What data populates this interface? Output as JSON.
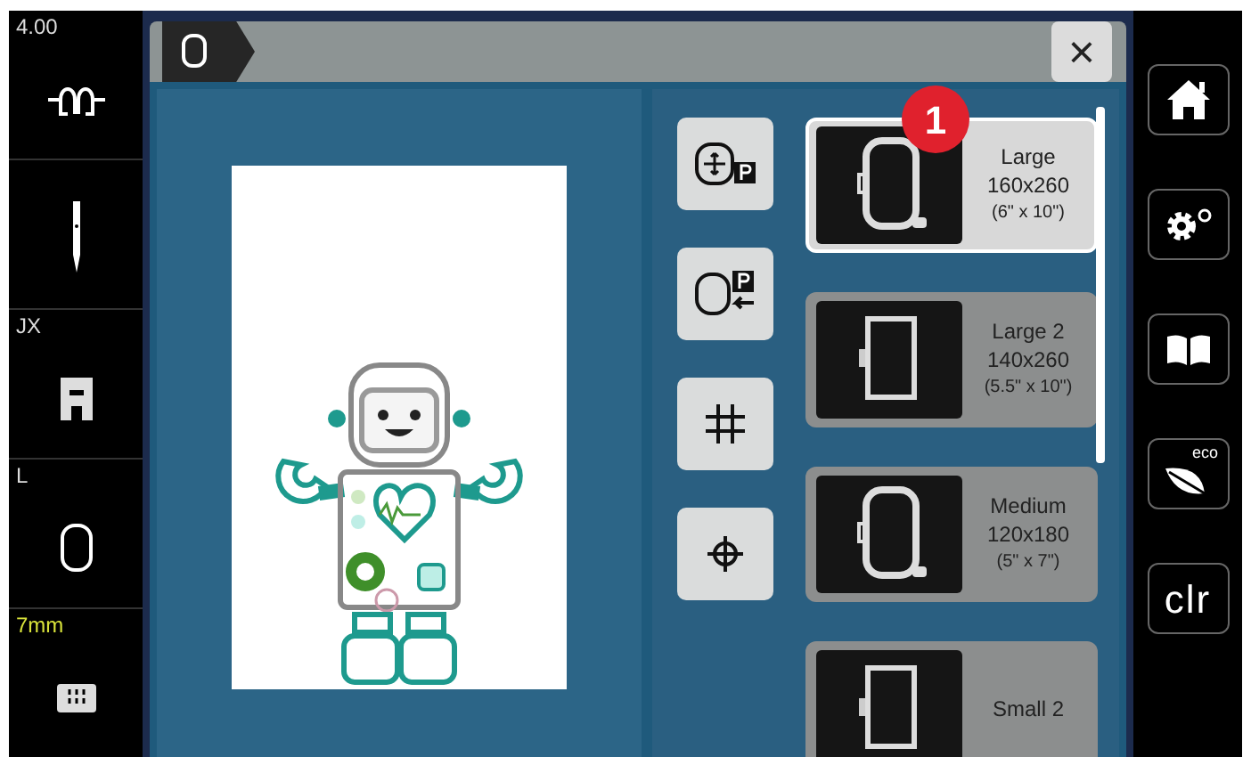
{
  "left_sidebar": [
    {
      "kind": "tension",
      "label": "4.00"
    },
    {
      "kind": "needle"
    },
    {
      "kind": "foot",
      "label": "JX"
    },
    {
      "kind": "hoop",
      "label": "L"
    },
    {
      "kind": "plate",
      "label": "7mm",
      "highlight": true
    }
  ],
  "dialog": {
    "close": "×",
    "callout": "1",
    "tools": [
      {
        "kind": "center-p"
      },
      {
        "kind": "hoop-p"
      },
      {
        "kind": "grid"
      },
      {
        "kind": "crosshair"
      }
    ],
    "hoops": [
      {
        "name": "Large",
        "size": "160x260",
        "inches": "(6\" x 10\")",
        "selected": true,
        "kind": "oval"
      },
      {
        "name": "Large 2",
        "size": "140x260",
        "inches": "(5.5\" x 10\")",
        "selected": false,
        "kind": "rect"
      },
      {
        "name": "Medium",
        "size": "120x180",
        "inches": "(5\" x 7\")",
        "selected": false,
        "kind": "oval"
      },
      {
        "name": "Small 2",
        "selected": false,
        "kind": "rect"
      }
    ]
  },
  "right_sidebar": [
    {
      "kind": "home"
    },
    {
      "kind": "settings"
    },
    {
      "kind": "tutorial"
    },
    {
      "kind": "eco",
      "label": "eco"
    },
    {
      "kind": "clear",
      "label": "clr"
    }
  ]
}
